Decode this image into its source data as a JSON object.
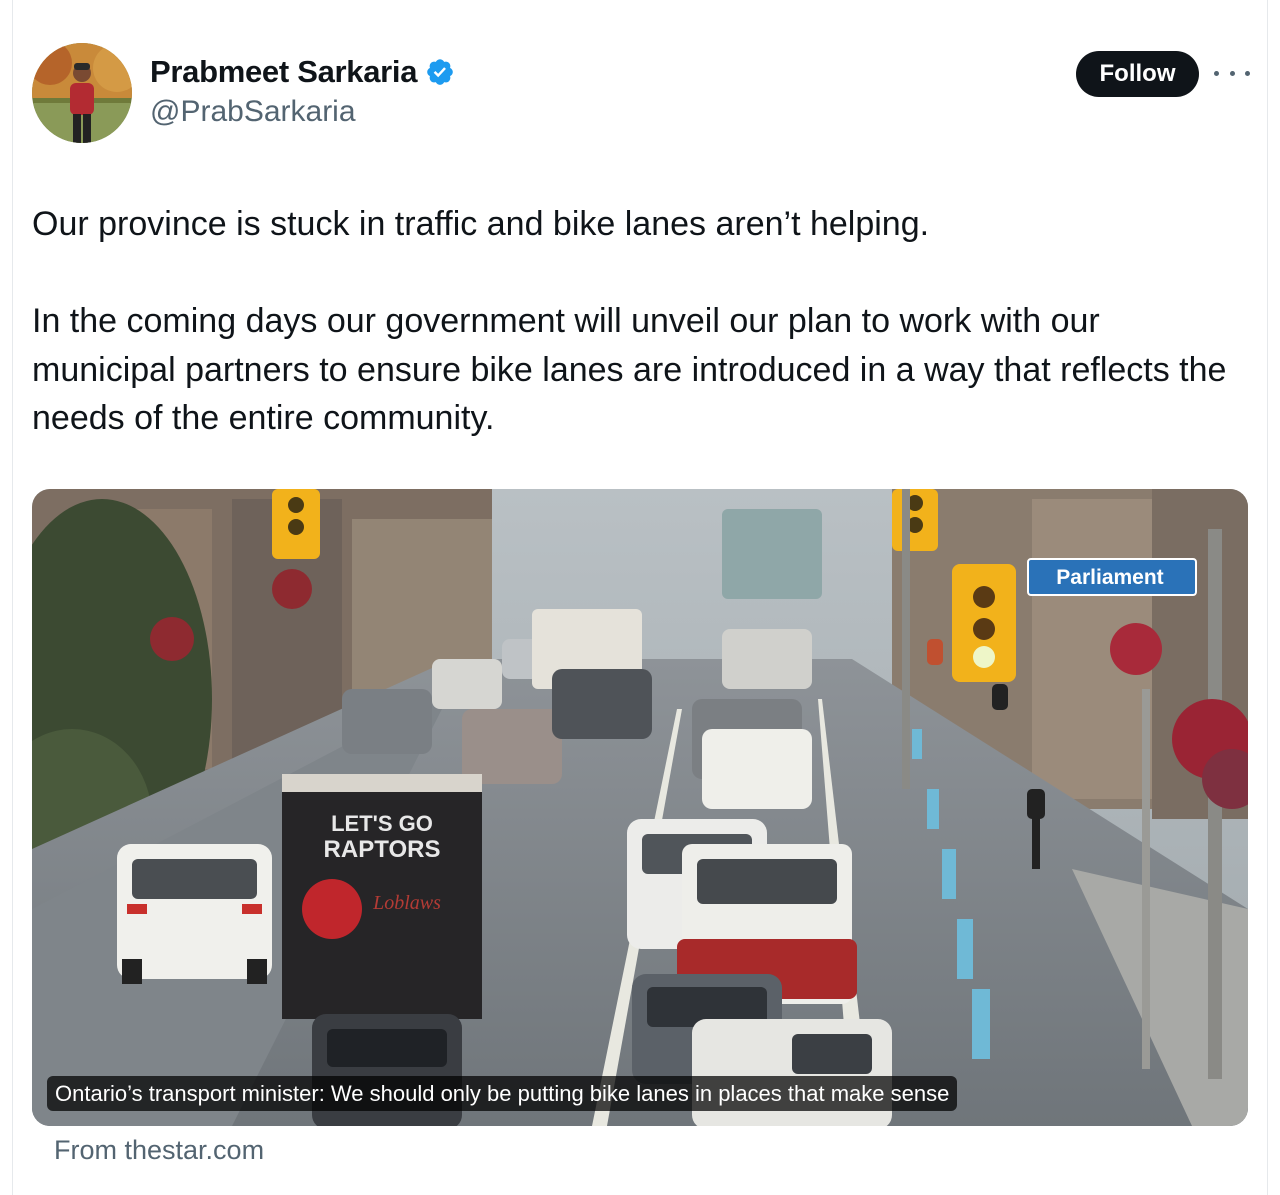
{
  "author": {
    "display_name": "Prabmeet Sarkaria",
    "handle": "@PrabSarkaria",
    "verified": true
  },
  "actions": {
    "follow_label": "Follow",
    "more_icon": "more-horizontal-icon"
  },
  "tweet": {
    "paragraphs": [
      "Our province is stuck in traffic and bike lanes aren’t helping.",
      "In the coming days our government will unveil our plan to work with our municipal partners to ensure bike lanes are introduced in a way that reflects the needs of the entire community."
    ]
  },
  "link_card": {
    "title": "Ontario’s transport minister: We should only be putting bike lanes in places that make sense",
    "source": "From thestar.com",
    "image_signs": {
      "street_sign": "Parliament",
      "truck_line1": "LET'S GO",
      "truck_line2": "RAPTORS",
      "truck_brand": "Loblaws"
    }
  },
  "colors": {
    "text": "#0f1419",
    "secondary_text": "#536471",
    "verified_blue": "#1d9bf0",
    "follow_bg": "#0f1419"
  }
}
